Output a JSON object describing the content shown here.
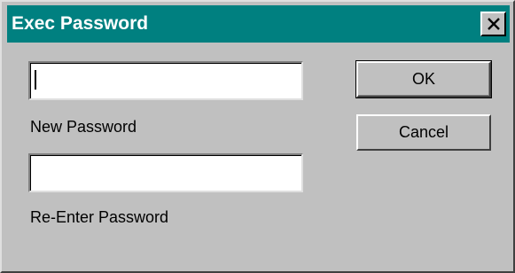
{
  "window": {
    "title": "Exec Password",
    "close_icon": "close-x-icon",
    "title_bar_color": "#008080",
    "background_color": "#c0c0c0"
  },
  "form": {
    "new_password": {
      "value": "",
      "label": "New Password"
    },
    "reenter_password": {
      "value": "",
      "label": "Re-Enter Password"
    }
  },
  "buttons": {
    "ok_label": "OK",
    "cancel_label": "Cancel"
  }
}
